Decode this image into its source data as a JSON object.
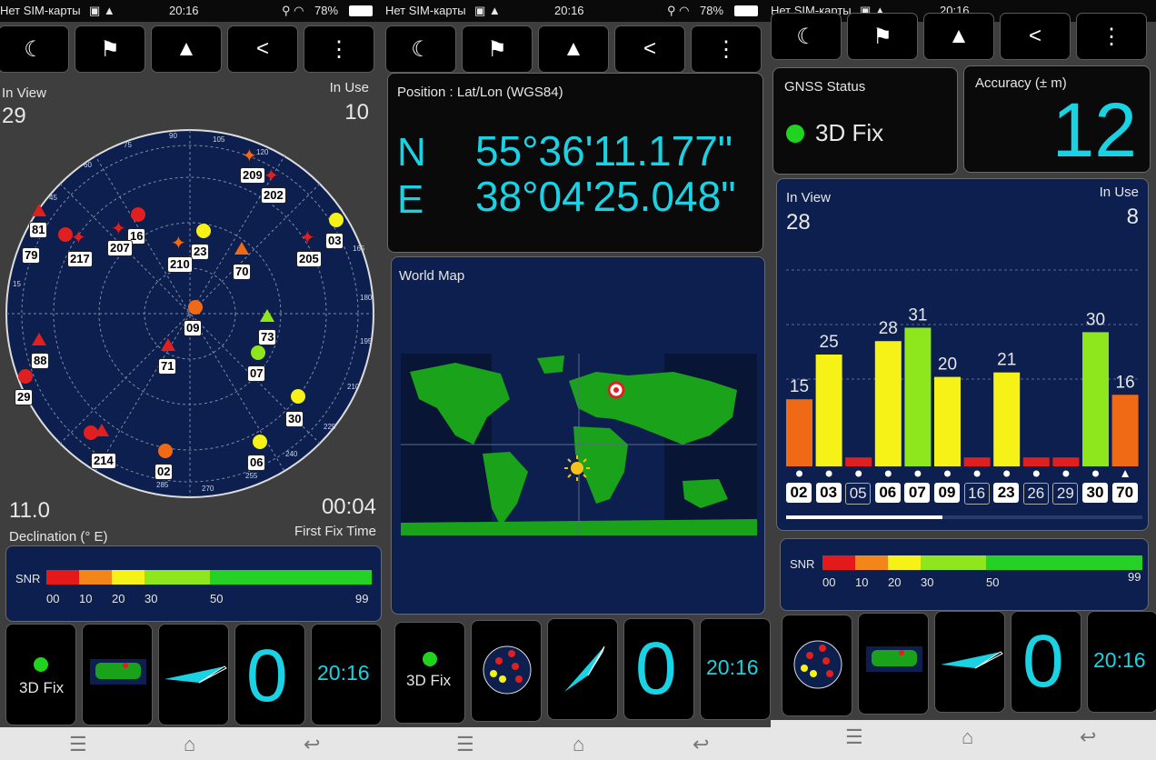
{
  "status": {
    "carrier": "Нет SIM-карты",
    "time": "20:16",
    "battery": "78%",
    "icons": [
      "sim-icon",
      "warning-icon",
      "location-icon",
      "wifi-icon",
      "battery-icon"
    ]
  },
  "toolbar": {
    "buttons": [
      {
        "name": "night-mode",
        "icon": "moon-icon"
      },
      {
        "name": "directions",
        "icon": "person-flag-icon"
      },
      {
        "name": "navigate",
        "icon": "navigation-arrow-icon"
      },
      {
        "name": "share",
        "icon": "share-icon"
      },
      {
        "name": "overflow-menu",
        "icon": "more-vert-icon"
      }
    ]
  },
  "colors": {
    "accent": "#19d3e4",
    "navy": "#0d1f4e",
    "fix_green": "#1fd31f"
  },
  "pane1": {
    "in_view_label": "In View",
    "in_view": "29",
    "in_use_label": "In Use",
    "in_use": "10",
    "declination_value": "11.0",
    "declination_label": "Declination (° E)",
    "fix_time_value": "00:04",
    "fix_time_label": "First Fix Time",
    "azimuth_ticks": [
      "90",
      "105",
      "120",
      "75",
      "60",
      "45",
      "15",
      "180",
      "195",
      "210",
      "225",
      "240",
      "255",
      "270",
      "285",
      "165"
    ],
    "satellites": [
      "209",
      "202",
      "81",
      "16",
      "207",
      "217",
      "03",
      "23",
      "210",
      "70",
      "205",
      "79",
      "09",
      "73",
      "88",
      "71",
      "07",
      "29",
      "30",
      "214",
      "02",
      "06"
    ]
  },
  "pane2": {
    "position_title": "Position : Lat/Lon (WGS84)",
    "lat_hemi": "N",
    "lat": "55°36'11.177\"",
    "lon_hemi": "E",
    "lon": "38°04'25.048\"",
    "world_map_title": "World Map"
  },
  "pane3": {
    "gnss_title": "GNSS Status",
    "fix_text": "3D Fix",
    "accuracy_title": "Accuracy (± m)",
    "accuracy_value": "12",
    "in_view_label": "In View",
    "in_view": "28",
    "in_use_label": "In Use",
    "in_use": "8"
  },
  "snr": {
    "label": "SNR",
    "ticks": [
      "00",
      "10",
      "20",
      "30",
      "50",
      "99"
    ]
  },
  "chart_data": {
    "type": "bar",
    "categories": [
      "02",
      "03",
      "05",
      "06",
      "07",
      "09",
      "16",
      "23",
      "26",
      "29",
      "30",
      "70"
    ],
    "values": [
      15,
      25,
      2,
      28,
      31,
      20,
      2,
      21,
      2,
      2,
      30,
      16
    ],
    "labels": [
      "15",
      "25",
      "",
      "28",
      "31",
      "20",
      "",
      "21",
      "",
      "",
      "30",
      "16"
    ],
    "in_use": [
      true,
      true,
      false,
      true,
      true,
      true,
      false,
      true,
      false,
      false,
      true,
      true
    ],
    "colors": [
      "#f06a16",
      "#f6f218",
      "#e02020",
      "#f6f218",
      "#8ee61c",
      "#f6f218",
      "#e02020",
      "#f6f218",
      "#e02020",
      "#e02020",
      "#8ee61c",
      "#f06a16"
    ],
    "ylim": [
      0,
      50
    ]
  },
  "bottom": {
    "fix_text": "3D Fix",
    "speed": "0",
    "clock": "20:16"
  }
}
